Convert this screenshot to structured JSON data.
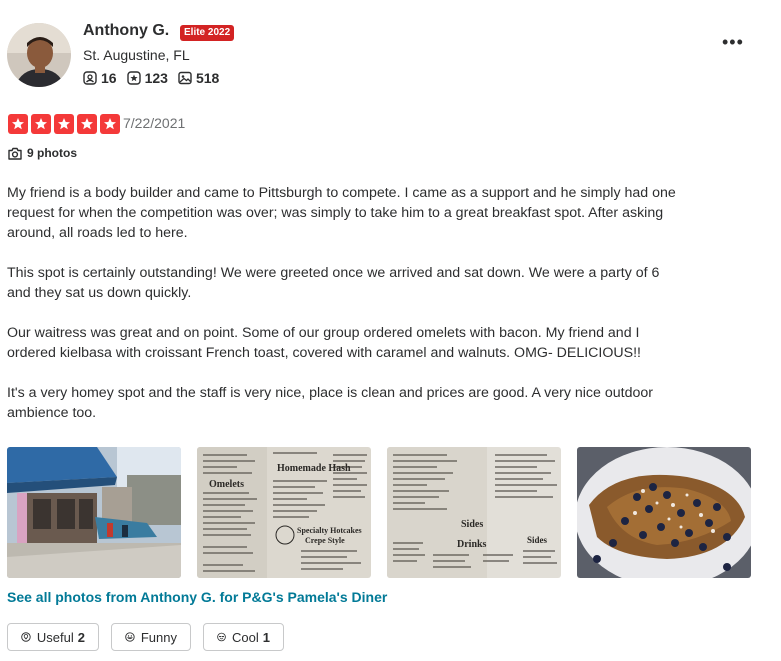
{
  "user": {
    "name": "Anthony G.",
    "elite_badge": "Elite 2022",
    "location": "St. Augustine, FL",
    "friends": "16",
    "reviews": "123",
    "photos": "518"
  },
  "review": {
    "rating": 5,
    "date": "7/22/2021",
    "photo_count_label": "9 photos",
    "paragraphs": [
      "My friend is a body builder and came to Pittsburgh to compete.  I came as a support and he simply had one request for when the competition was over; was simply to take him to a great breakfast spot. After asking around, all roads led to here.",
      "This spot is certainly outstanding! We were greeted once we arrived and sat down. We were a party of 6 and they sat us down quickly.",
      "Our waitress was great and on point. Some of our group ordered omelets with bacon. My friend and I ordered kielbasa with croissant French toast, covered with caramel and walnuts. OMG- DELICIOUS!!",
      "It's a very homey spot and the staff is very nice, place is clean and prices are good. A very nice outdoor ambience too."
    ],
    "see_all_link": "See all photos from Anthony G. for P&G's Pamela's Diner"
  },
  "photos": {
    "menu1": {
      "headings": [
        "Homemade Hash",
        "Omelets",
        "Specialty Hotcakes",
        "Crepe Style"
      ]
    },
    "menu2": {
      "headings": [
        "Sides",
        "Drinks",
        "Sides"
      ]
    }
  },
  "reactions": {
    "useful_label": "Useful",
    "useful_count": "2",
    "funny_label": "Funny",
    "cool_label": "Cool",
    "cool_count": "1"
  },
  "colors": {
    "star_red": "#f43939",
    "elite_red": "#d32323",
    "link_teal": "#027a97"
  }
}
